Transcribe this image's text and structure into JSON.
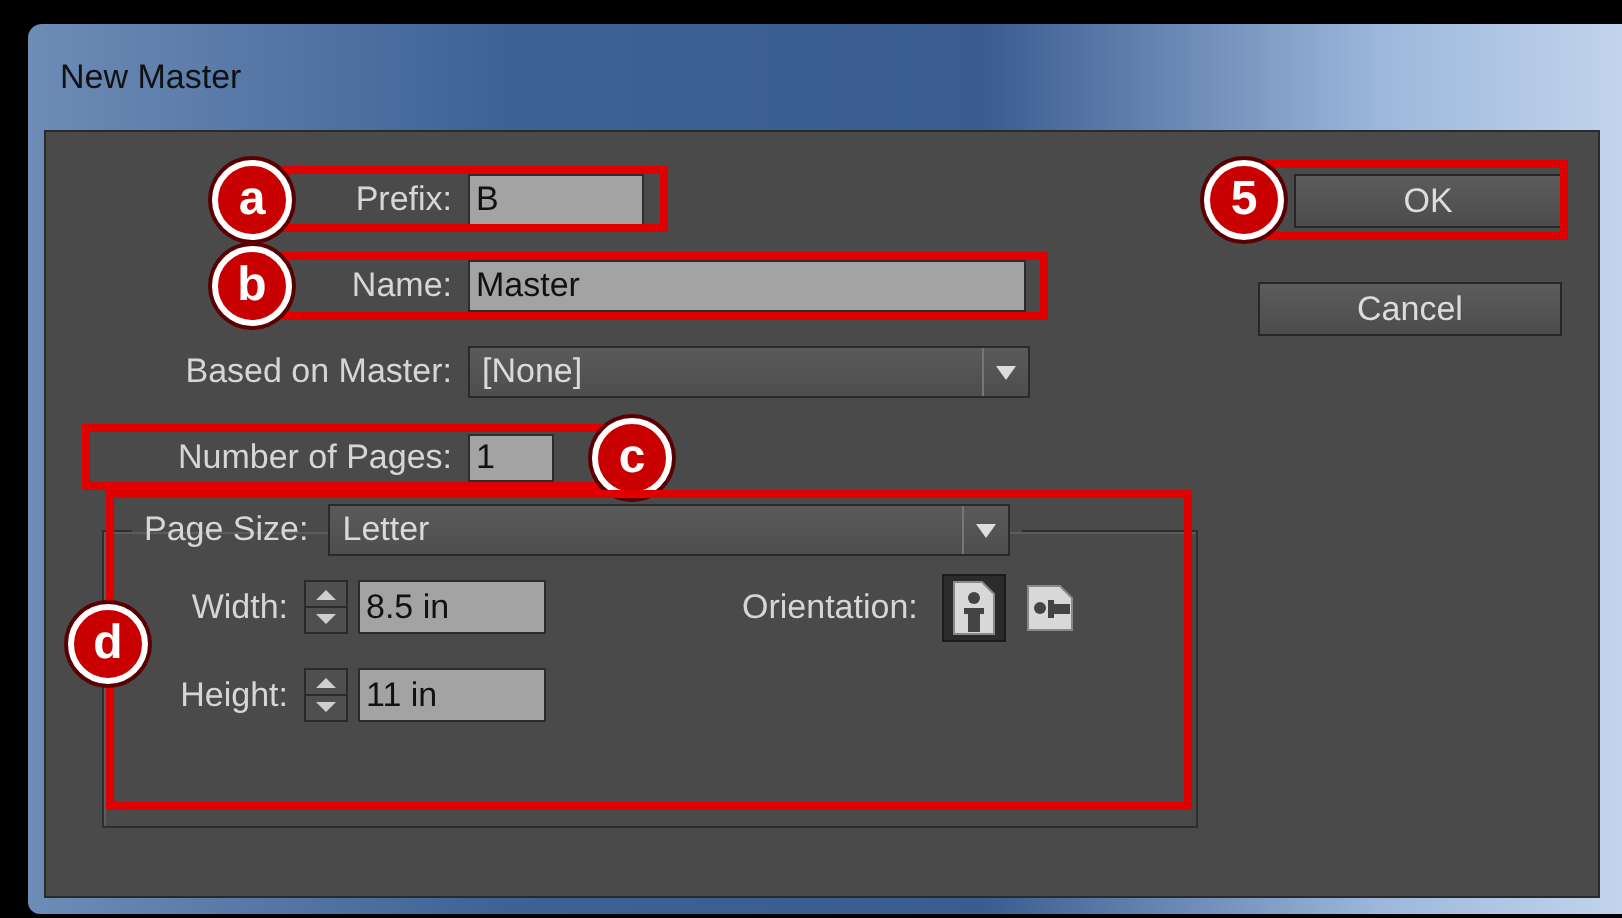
{
  "window": {
    "title": "New Master"
  },
  "prefix": {
    "label": "Prefix:",
    "value": "B",
    "marker": "a"
  },
  "name": {
    "label": "Name:",
    "value": "Master",
    "marker": "b"
  },
  "based_on_master": {
    "label": "Based on Master:",
    "value": "[None]"
  },
  "number_of_pages": {
    "label": "Number of Pages:",
    "value": "1",
    "marker": "c"
  },
  "page_size": {
    "label": "Page Size:",
    "value": "Letter",
    "marker": "d",
    "width": {
      "label": "Width:",
      "value": "8.5 in"
    },
    "height": {
      "label": "Height:",
      "value": "11 in"
    },
    "orientation": {
      "label": "Orientation:",
      "options": [
        {
          "kind": "portrait",
          "selected": true
        },
        {
          "kind": "landscape",
          "selected": false
        }
      ]
    }
  },
  "buttons": [
    {
      "label": "OK",
      "marker": "5"
    },
    {
      "label": "Cancel"
    }
  ]
}
